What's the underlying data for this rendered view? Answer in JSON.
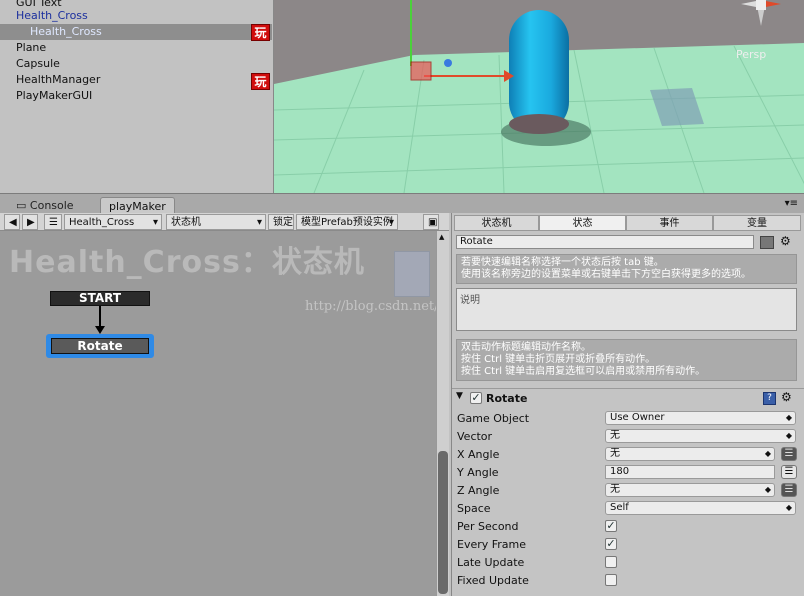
{
  "hierarchy": {
    "items": [
      {
        "label": "GUI Text"
      },
      {
        "label": "Health_Cross"
      },
      {
        "label": "Health_Cross"
      },
      {
        "label": "Plane"
      },
      {
        "label": "Capsule"
      },
      {
        "label": "HealthManager"
      },
      {
        "label": "PlayMakerGUI"
      }
    ],
    "badge_glyph": "玩"
  },
  "scene": {
    "persp_label": "Persp",
    "colors": {
      "floor": "#a3e4c0",
      "capsule": "#1db6e8",
      "sky": "#8c8788"
    }
  },
  "tabs": {
    "console": "Console",
    "playmaker": "playMaker"
  },
  "toolbar": {
    "fsm_select": "Health_Cross",
    "fsm_name_select": "状态机",
    "lock": "锁定",
    "prefab_select": "模型Prefab预设实例"
  },
  "graph": {
    "title": "Health_Cross：状态机",
    "watermark": "http://blog.csdn.net/",
    "states": {
      "start": "START",
      "rotate": "Rotate"
    }
  },
  "inspector": {
    "tabs": [
      "状态机",
      "状态",
      "事件",
      "变量"
    ],
    "state_name": "Rotate",
    "hint1": [
      "若要快速编辑名称选择一个状态后按 tab 键。",
      "使用该名称旁边的设置菜单或右键单击下方空白获得更多的选项。"
    ],
    "description_placeholder": "说明",
    "hint2": [
      "双击动作标题编辑动作名称。",
      "按住 Ctrl 键单击折页展开或折叠所有动作。",
      "按住 Ctrl 键单击启用复选框可以启用或禁用所有动作。"
    ],
    "action_title": "Rotate",
    "properties": [
      {
        "label": "Game Object",
        "value": "Use Owner"
      },
      {
        "label": "Vector",
        "value": "无"
      },
      {
        "label": "X Angle",
        "value": "无"
      },
      {
        "label": "Y Angle",
        "value": "180"
      },
      {
        "label": "Z Angle",
        "value": "无"
      },
      {
        "label": "Space",
        "value": "Self"
      },
      {
        "label": "Per Second",
        "checked": true
      },
      {
        "label": "Every Frame",
        "checked": true
      },
      {
        "label": "Late Update",
        "checked": false
      },
      {
        "label": "Fixed Update",
        "checked": false
      }
    ],
    "check_glyph": "✓"
  }
}
